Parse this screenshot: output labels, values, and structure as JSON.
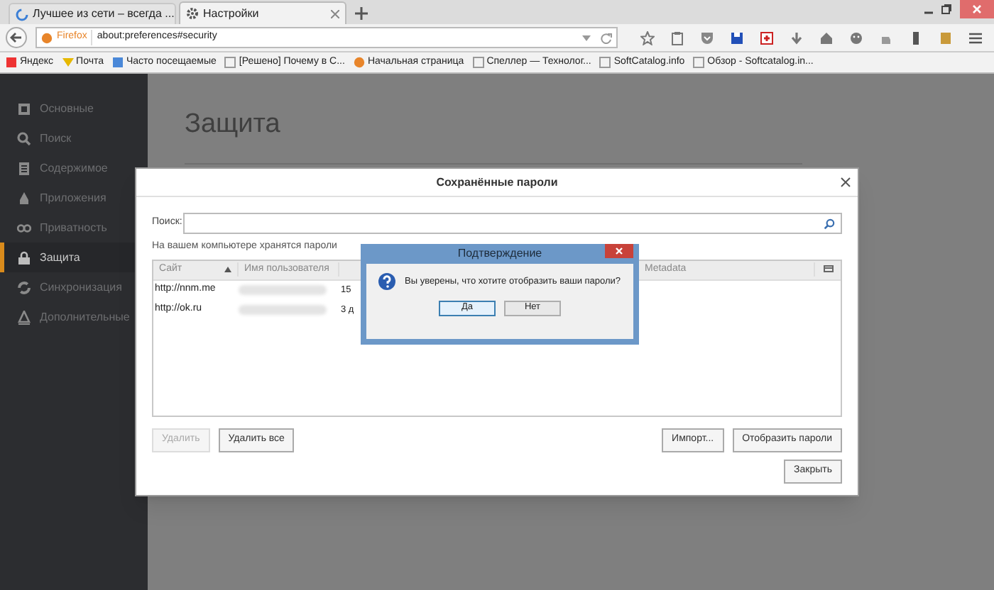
{
  "tabs": [
    {
      "label": "Лучшее из сети – всегда ...",
      "selected": false
    },
    {
      "label": "Настройки",
      "selected": true
    }
  ],
  "url_bar": {
    "identity": "Firefox",
    "value": "about:preferences#security"
  },
  "bookmarks": [
    "Яндекс",
    "Почта",
    "Часто посещаемые",
    "[Решено] Почему в С...",
    "Начальная страница",
    "Спеллер — Технолог...",
    "SoftCatalog.info",
    "Обзор - Softcatalog.in..."
  ],
  "sidebar": {
    "items": [
      {
        "label": "Основные",
        "selected": false
      },
      {
        "label": "Поиск",
        "selected": false
      },
      {
        "label": "Содержимое",
        "selected": false
      },
      {
        "label": "Приложения",
        "selected": false
      },
      {
        "label": "Приватность",
        "selected": false
      },
      {
        "label": "Защита",
        "selected": true
      },
      {
        "label": "Синхронизация",
        "selected": false
      },
      {
        "label": "Дополнительные",
        "selected": false
      }
    ]
  },
  "page": {
    "heading": "Защита"
  },
  "passwords_dialog": {
    "title": "Сохранённые пароли",
    "search_label": "Поиск:",
    "note": "На вашем компьютере хранятся пароли",
    "columns": [
      "Сайт",
      "Имя пользователя",
      "Metadata"
    ],
    "rows": [
      {
        "site": "http://nnm.me",
        "column_3": "15"
      },
      {
        "site": "http://ok.ru",
        "column_3": "3 д"
      }
    ],
    "left_buttons": [
      {
        "label": "Удалить",
        "disabled": true
      },
      {
        "label": "Удалить все",
        "disabled": false
      }
    ],
    "right_buttons": [
      {
        "label": "Импорт...",
        "disabled": false
      },
      {
        "label": "Отобразить пароли",
        "disabled": false
      }
    ],
    "close_button": "Закрыть"
  },
  "confirm_dialog": {
    "title": "Подтверждение",
    "message": "Вы уверены, что хотите отобразить ваши пароли?",
    "buttons": [
      {
        "label": "Да",
        "selected": true
      },
      {
        "label": "Нет",
        "selected": false
      }
    ]
  }
}
